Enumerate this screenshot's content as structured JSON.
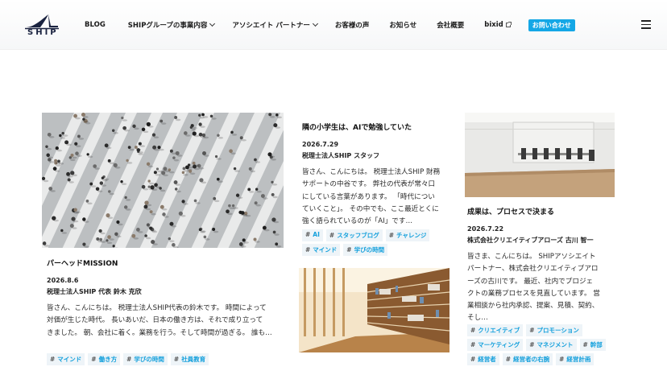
{
  "header": {
    "logo_text": "SHIP",
    "nav": [
      {
        "label": "BLOG"
      },
      {
        "label": "SHIPグループの事業内容"
      },
      {
        "label": "アソシエイト パートナー"
      },
      {
        "label": "お客様の声"
      },
      {
        "label": "お知らせ"
      },
      {
        "label": "会社概要"
      },
      {
        "label": "bixid"
      }
    ],
    "contact_label": "お問い合わせ"
  },
  "cards": [
    {
      "title": "パーヘッドMISSION",
      "date": "2026.8.6",
      "author": "税理士法人SHIP 代表 鈴木 克欣",
      "excerpt": [
        "皆さん、こんにちは。 税理士法人SHIP代表の鈴木です。 時間によって",
        "対価が生じた時代。 長いあいだ、日本の働き方は、それで成り立って",
        "きました。 朝、会社に着く。業務を行う。そして時間が過ぎる。 誰も…"
      ],
      "tags": [
        "マインド",
        "働き方",
        "学びの時間",
        "社員教育"
      ]
    },
    {
      "title": "隣の小学生は、AIで勉強していた",
      "date": "2026.7.29",
      "author": "税理士法人SHIP スタッフ",
      "excerpt": [
        "皆さん、こんにちは。 税理士法人SHIP 財務",
        "サポートの中谷です。 弊社の代表が常々口",
        "にしている言葉があります。 「時代につい",
        "ていくこと」。 その中でも、ここ最近とくに",
        "強く語られているのが「AI」です…"
      ],
      "tags": [
        "AI",
        "スタッフブログ",
        "チャレンジ",
        "マインド",
        "学びの時間"
      ]
    },
    {
      "title": "成果は、プロセスで決まる",
      "date": "2026.7.22",
      "author": "株式会社クリエイティブアローズ 古川 智一",
      "excerpt": [
        "皆さま、こんにちは。 SHIPアソシエイト",
        "パートナー、株式会社クリエイティブアロ",
        "ーズの古川です。 最近、社内でプロジェ",
        "クトの業務プロセスを見直しています。 営",
        "業相談から社内承認、提案、見積、契約、",
        "そし…"
      ],
      "tags": [
        "クリエイティブ",
        "プロモーション",
        "マーケティング",
        "マネジメント",
        "幹部",
        "経営者",
        "経営者の右腕",
        "経営計画"
      ]
    }
  ]
}
